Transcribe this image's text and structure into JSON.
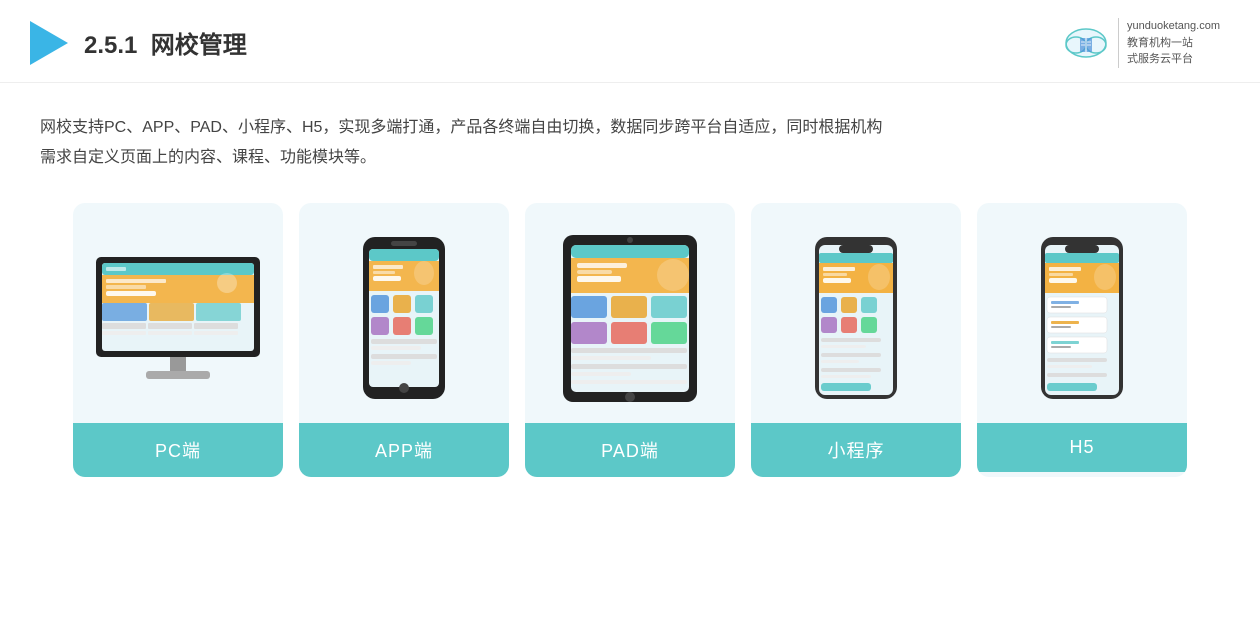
{
  "header": {
    "section_number": "2.5.1",
    "title_plain": "网校管理",
    "brand_line1": "教育机构一站",
    "brand_line2": "式服务云平台",
    "brand_url": "yunduoketang.com"
  },
  "description": {
    "line1": "网校支持PC、APP、PAD、小程序、H5，实现多端打通，产品各终端自由切换，数据同步跨平台自适应，同时根据机构",
    "line2": "需求自定义页面上的内容、课程、功能模块等。"
  },
  "cards": [
    {
      "id": "pc",
      "label": "PC端"
    },
    {
      "id": "app",
      "label": "APP端"
    },
    {
      "id": "pad",
      "label": "PAD端"
    },
    {
      "id": "miniprogram",
      "label": "小程序"
    },
    {
      "id": "h5",
      "label": "H5"
    }
  ]
}
